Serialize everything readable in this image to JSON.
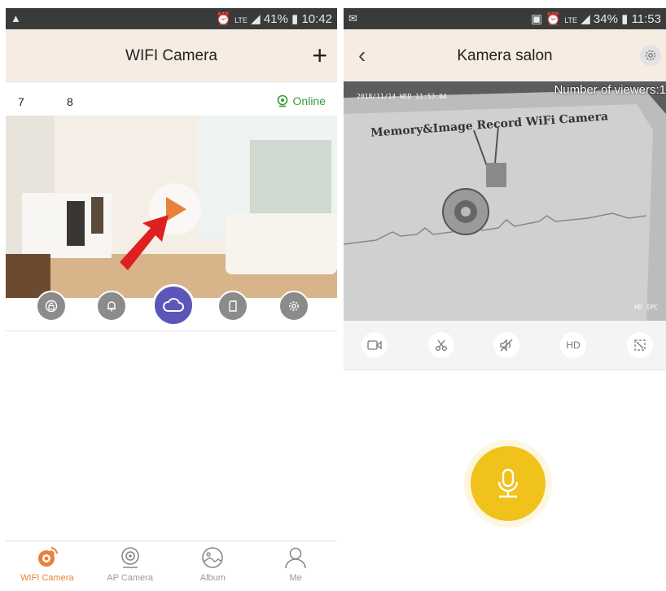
{
  "left": {
    "status": {
      "time": "10:42",
      "battery": "41%",
      "network": "LTE"
    },
    "title": "WIFI Camera",
    "camera_nums": [
      "7",
      "8"
    ],
    "online_label": "Online",
    "bottom_nav": [
      {
        "label": "WIFI Camera",
        "icon": "camera-icon",
        "active": true
      },
      {
        "label": "AP Camera",
        "icon": "webcam-icon",
        "active": false
      },
      {
        "label": "Album",
        "icon": "album-icon",
        "active": false
      },
      {
        "label": "Me",
        "icon": "person-icon",
        "active": false
      }
    ]
  },
  "right": {
    "status": {
      "time": "11:53",
      "battery": "34%",
      "network": "LTE"
    },
    "title": "Kamera salon",
    "viewers": "Number of viewers:1",
    "osd_time": "2018/11/14 WED 11:53:04",
    "osd_res": "HD IPC",
    "paper_text": "Memory&Image Record WiFi Camera",
    "controls": {
      "hd_label": "HD"
    }
  },
  "colors": {
    "accent_orange": "#e8813a",
    "cloud_purple": "#5b57b8",
    "online_green": "#3a9a3a",
    "mic_yellow": "#f2c21c",
    "titlebar_bg": "#f7ece2"
  }
}
